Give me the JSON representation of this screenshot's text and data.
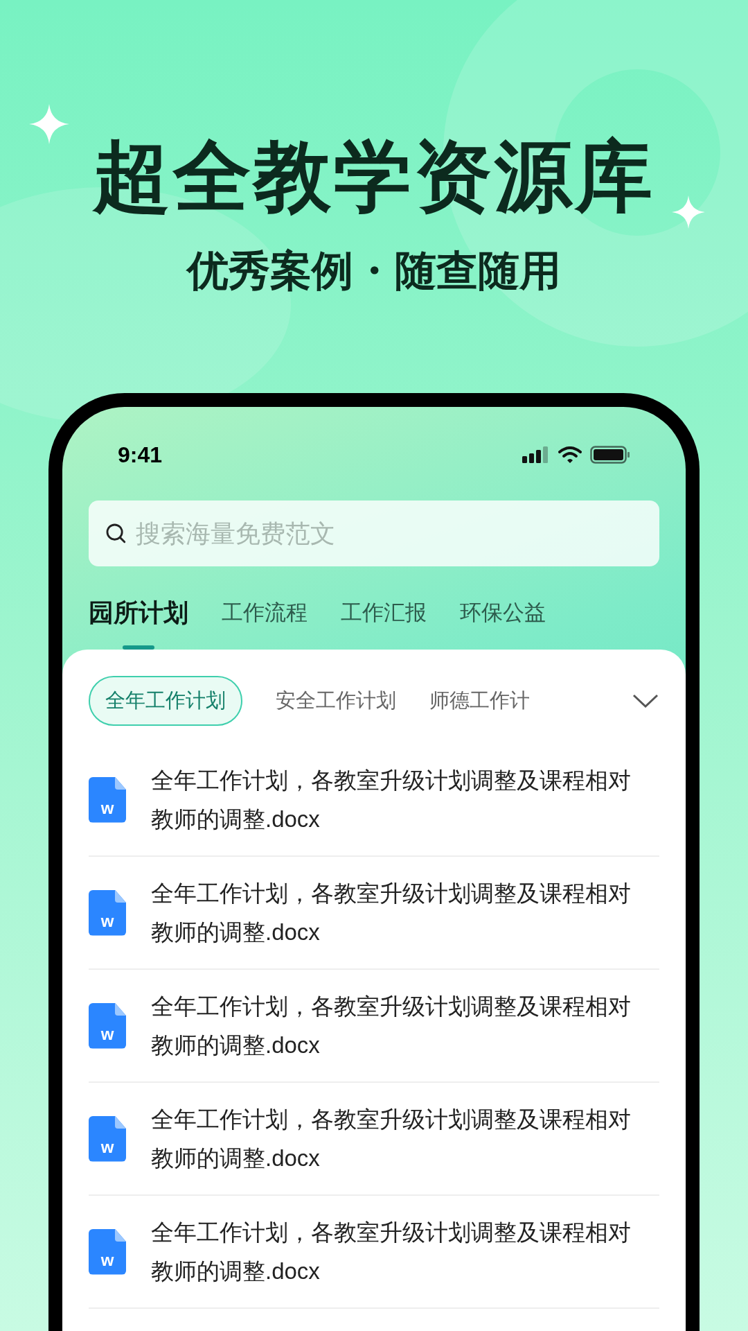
{
  "headline": {
    "title": "超全教学资源库",
    "subtitle": "优秀案例・随查随用"
  },
  "status_bar": {
    "time": "9:41"
  },
  "search": {
    "placeholder": "搜索海量免费范文"
  },
  "tabs": [
    {
      "label": "园所计划",
      "selected": true
    },
    {
      "label": "工作流程",
      "selected": false
    },
    {
      "label": "工作汇报",
      "selected": false
    },
    {
      "label": "环保公益",
      "selected": false
    }
  ],
  "chips": [
    {
      "label": "全年工作计划",
      "selected": true
    },
    {
      "label": "安全工作计划",
      "selected": false
    },
    {
      "label": "师德工作计",
      "selected": false
    }
  ],
  "files": [
    {
      "icon_letter": "w",
      "name": "全年工作计划，各教室升级计划调整及课程相对教师的调整.docx"
    },
    {
      "icon_letter": "w",
      "name": "全年工作计划，各教室升级计划调整及课程相对教师的调整.docx"
    },
    {
      "icon_letter": "w",
      "name": "全年工作计划，各教室升级计划调整及课程相对教师的调整.docx"
    },
    {
      "icon_letter": "w",
      "name": "全年工作计划，各教室升级计划调整及课程相对教师的调整.docx"
    },
    {
      "icon_letter": "w",
      "name": "全年工作计划，各教室升级计划调整及课程相对教师的调整.docx"
    }
  ]
}
